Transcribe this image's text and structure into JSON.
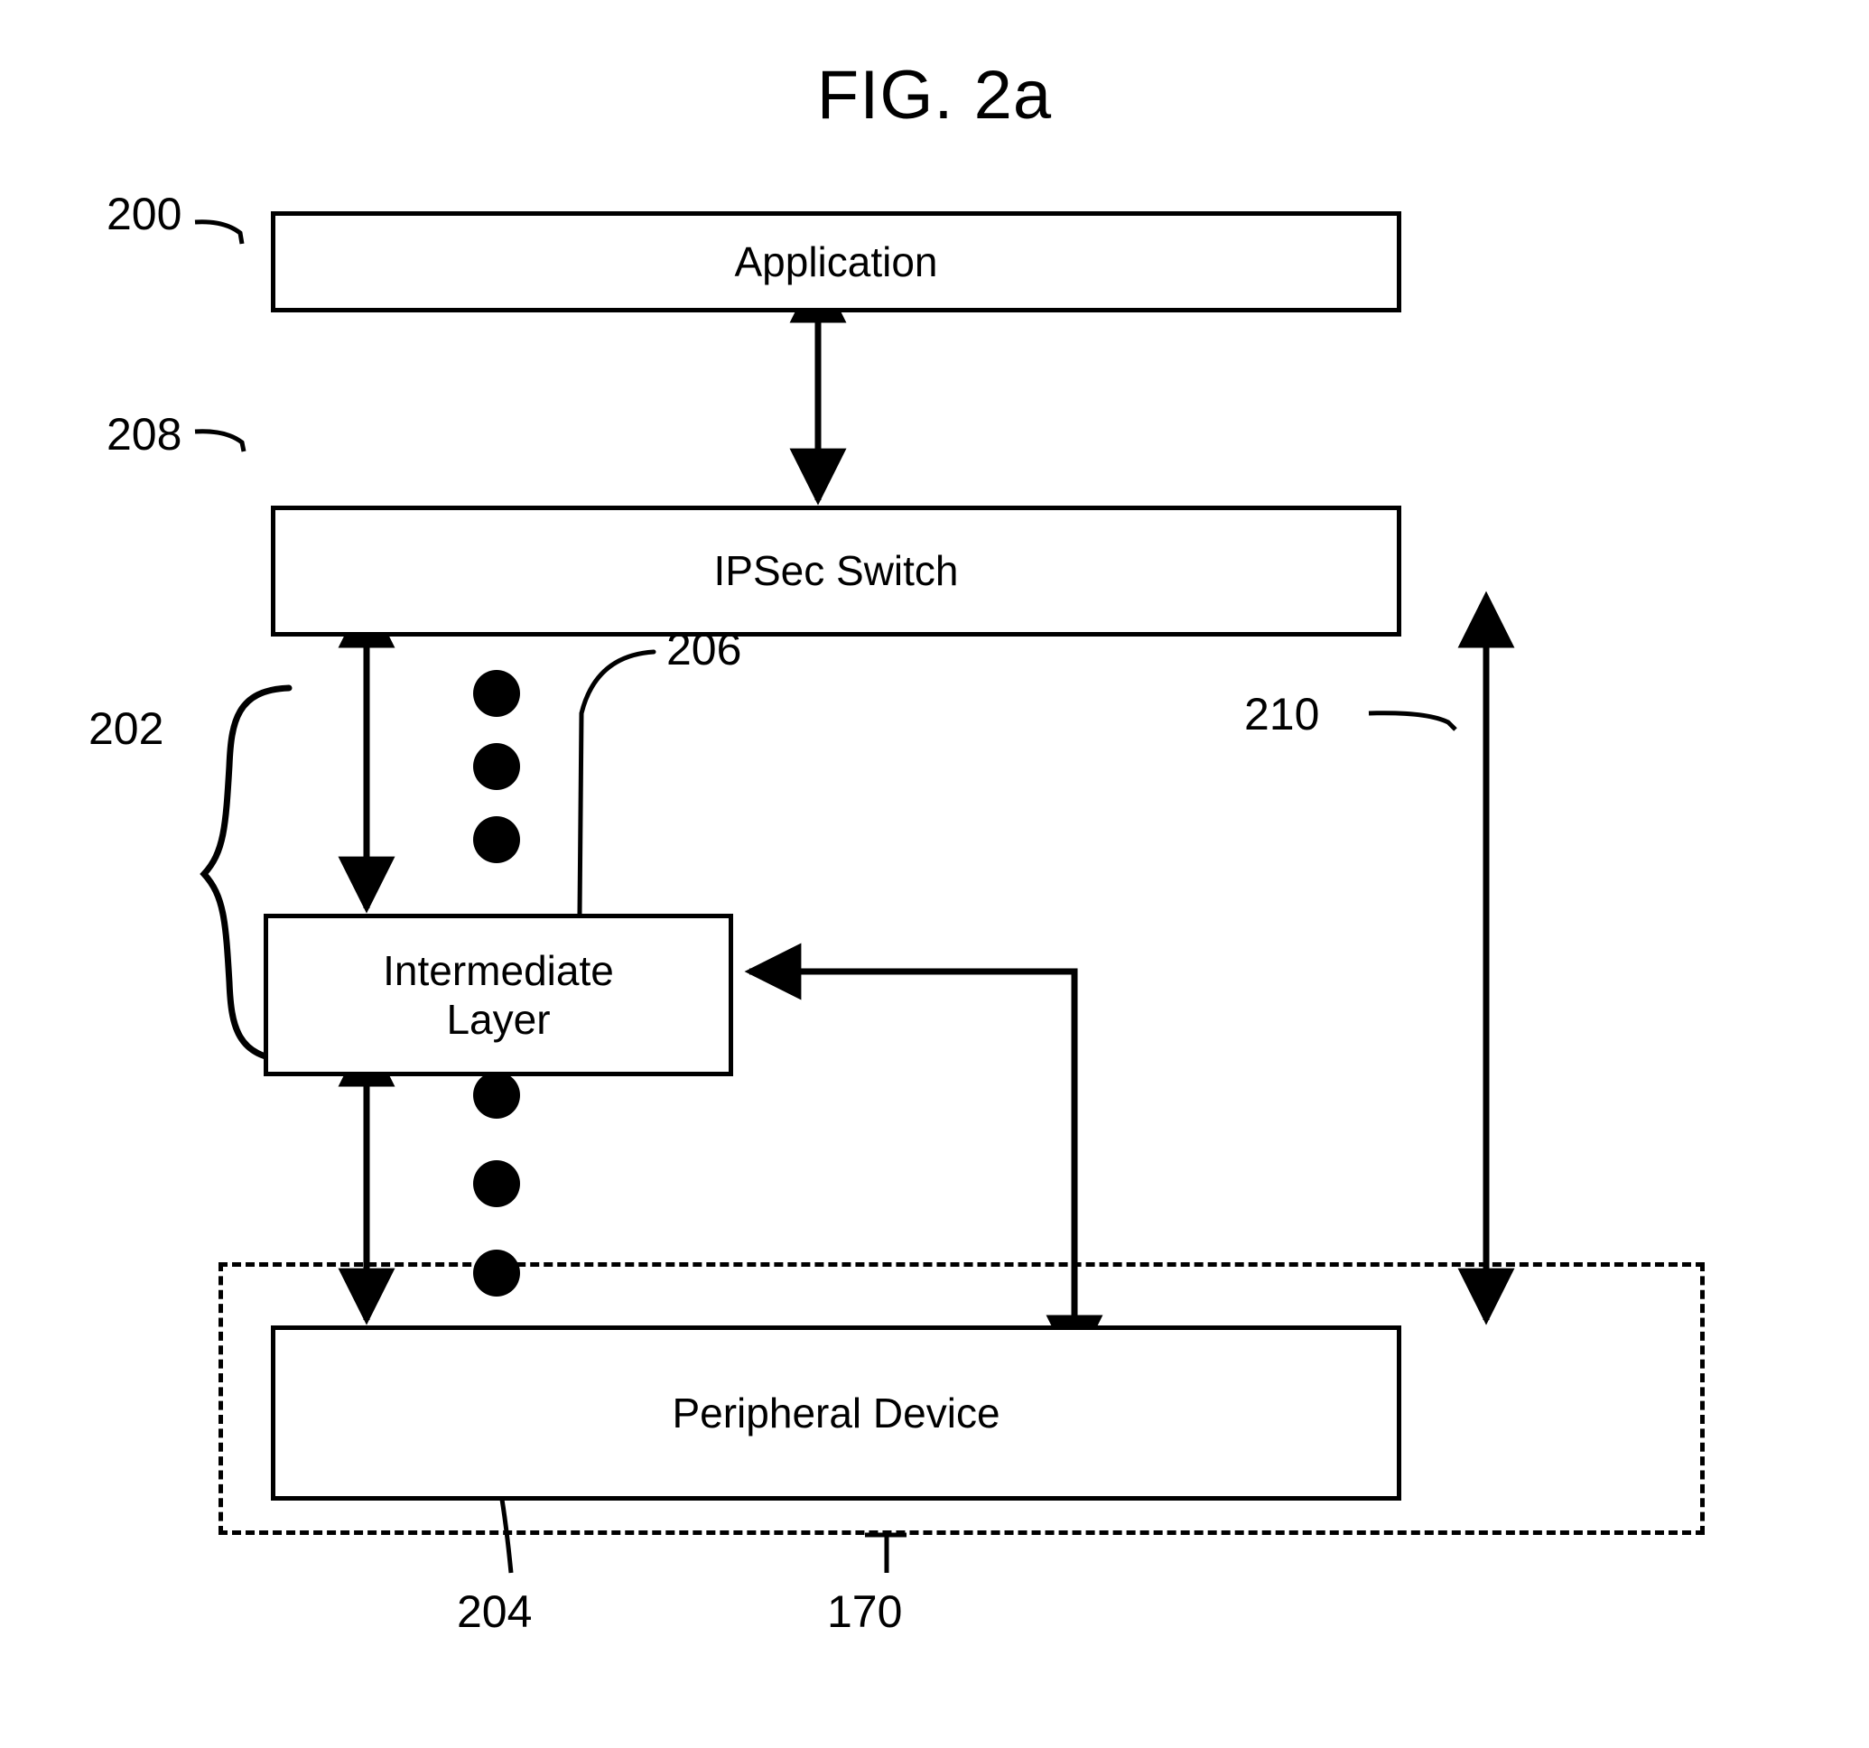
{
  "figure": {
    "title": "FIG. 2a",
    "ink_color": "#000000",
    "background_color": "#ffffff"
  },
  "boxes": {
    "application": {
      "label": "Application",
      "ref": "200"
    },
    "ipsec_switch": {
      "label": "IPSec Switch",
      "ref": "208"
    },
    "intermediate_layer": {
      "label": "Intermediate\nLayer",
      "line1": "Intermediate",
      "line2": "Layer",
      "ref": "206"
    },
    "peripheral_device": {
      "label": "Peripheral Device",
      "ref": "204"
    }
  },
  "reference_numerals": {
    "application_stack": "200",
    "protocol_stack_brace": "202",
    "peripheral_device": "204",
    "intermediate_layer": "206",
    "ipsec_switch": "208",
    "bypass_path": "210",
    "dashed_boundary": "170"
  },
  "connectors": {
    "application_to_ipsec": {
      "type": "double-arrow",
      "orientation": "vertical"
    },
    "ipsec_to_intermediate": {
      "type": "double-arrow",
      "orientation": "vertical"
    },
    "intermediate_to_peripheral": {
      "type": "double-arrow",
      "orientation": "vertical"
    },
    "ipsec_to_peripheral_direct": {
      "type": "double-arrow",
      "orientation": "vertical",
      "ref": "210"
    },
    "peripheral_to_intermediate_feedback": {
      "type": "single-arrow",
      "orientation": "L-shaped"
    }
  },
  "ellipsis_dots": {
    "upper_group_count": 3,
    "lower_group_count": 3,
    "meaning": "additional protocol stack layers"
  }
}
